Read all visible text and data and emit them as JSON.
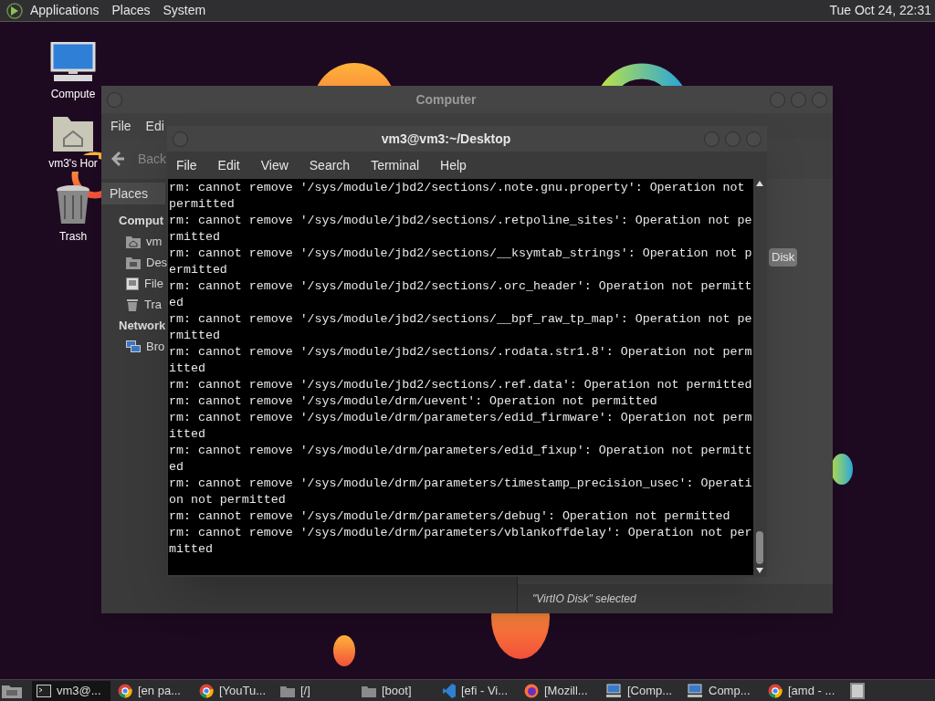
{
  "top_panel": {
    "menus": [
      "Applications",
      "Places",
      "System"
    ],
    "clock": "Tue Oct 24, 22:31"
  },
  "desktop_icons": [
    {
      "kind": "computer",
      "label": "Compute"
    },
    {
      "kind": "home",
      "label": "vm3's Hor"
    },
    {
      "kind": "trash",
      "label": "Trash"
    }
  ],
  "file_manager": {
    "title": "Computer",
    "menu": [
      "File",
      "Edi"
    ],
    "back": "Back",
    "places_header": "Places",
    "sidebar": [
      {
        "kind": "heading",
        "label": "Comput"
      },
      {
        "kind": "home",
        "label": "vm"
      },
      {
        "kind": "desktop",
        "label": "Des"
      },
      {
        "kind": "drive",
        "label": "File"
      },
      {
        "kind": "trash",
        "label": "Tra"
      },
      {
        "kind": "heading",
        "label": "Network"
      },
      {
        "kind": "network",
        "label": "Bro"
      }
    ],
    "item_label": "Disk",
    "status": "\"VirtIO Disk\" selected"
  },
  "terminal": {
    "title": "vm3@vm3:~/Desktop",
    "menu": [
      "File",
      "Edit",
      "View",
      "Search",
      "Terminal",
      "Help"
    ],
    "lines": [
      "rm: cannot remove '/sys/module/jbd2/sections/.note.gnu.property': Operation not",
      "permitted",
      "rm: cannot remove '/sys/module/jbd2/sections/.retpoline_sites': Operation not pe",
      "rmitted",
      "rm: cannot remove '/sys/module/jbd2/sections/__ksymtab_strings': Operation not p",
      "ermitted",
      "rm: cannot remove '/sys/module/jbd2/sections/.orc_header': Operation not permitt",
      "ed",
      "rm: cannot remove '/sys/module/jbd2/sections/__bpf_raw_tp_map': Operation not pe",
      "rmitted",
      "rm: cannot remove '/sys/module/jbd2/sections/.rodata.str1.8': Operation not perm",
      "itted",
      "rm: cannot remove '/sys/module/jbd2/sections/.ref.data': Operation not permitted",
      "rm: cannot remove '/sys/module/drm/uevent': Operation not permitted",
      "rm: cannot remove '/sys/module/drm/parameters/edid_firmware': Operation not perm",
      "itted",
      "rm: cannot remove '/sys/module/drm/parameters/edid_fixup': Operation not permitt",
      "ed",
      "rm: cannot remove '/sys/module/drm/parameters/timestamp_precision_usec': Operati",
      "on not permitted",
      "rm: cannot remove '/sys/module/drm/parameters/debug': Operation not permitted",
      "rm: cannot remove '/sys/module/drm/parameters/vblankoffdelay': Operation not per",
      "mitted"
    ]
  },
  "taskbar": {
    "items": [
      {
        "kind": "terminal",
        "label": "vm3@...",
        "selected": true
      },
      {
        "kind": "chrome",
        "label": "[en pa...",
        "selected": false
      },
      {
        "kind": "chrome",
        "label": "[YouTu...",
        "selected": false
      },
      {
        "kind": "folder",
        "label": "[/]",
        "selected": false
      },
      {
        "kind": "folder",
        "label": "[boot]",
        "selected": false
      },
      {
        "kind": "vscode",
        "label": "[efi - Vi...",
        "selected": false
      },
      {
        "kind": "firefox",
        "label": "[Mozill...",
        "selected": false
      },
      {
        "kind": "computer",
        "label": "[Comp...",
        "selected": false
      },
      {
        "kind": "computer",
        "label": "Comp...",
        "selected": false
      },
      {
        "kind": "chrome",
        "label": "[amd - ...",
        "selected": false
      }
    ]
  }
}
